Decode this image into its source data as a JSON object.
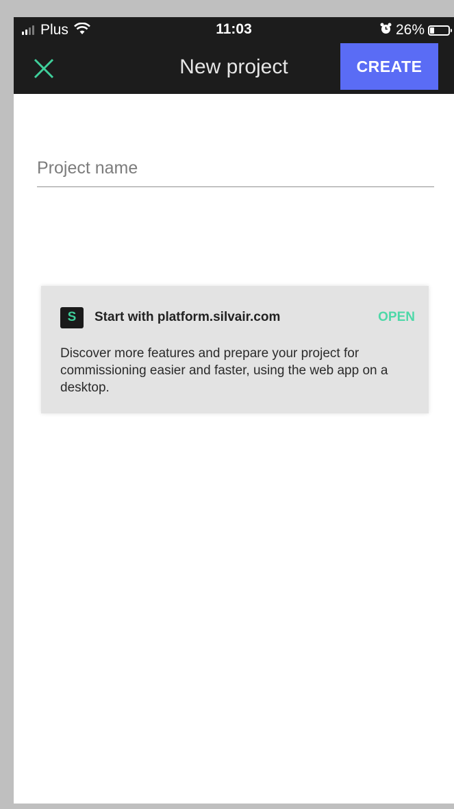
{
  "status_bar": {
    "carrier": "Plus",
    "time": "11:03",
    "battery_percent": "26%",
    "battery_level": 0.26,
    "signal_bars_active": 2,
    "signal_bars_total": 4
  },
  "nav": {
    "title": "New project",
    "create_label": "CREATE",
    "close_icon": "close-icon",
    "accent_color": "#5a6cf5",
    "close_color": "#3fcf9b"
  },
  "form": {
    "project_name_placeholder": "Project name",
    "project_name_value": ""
  },
  "card": {
    "logo_letter": "S",
    "title": "Start with platform.silvair.com",
    "open_label": "OPEN",
    "description": "Discover more features and prepare your project for commissioning easier and faster, using the web app on a desktop."
  }
}
